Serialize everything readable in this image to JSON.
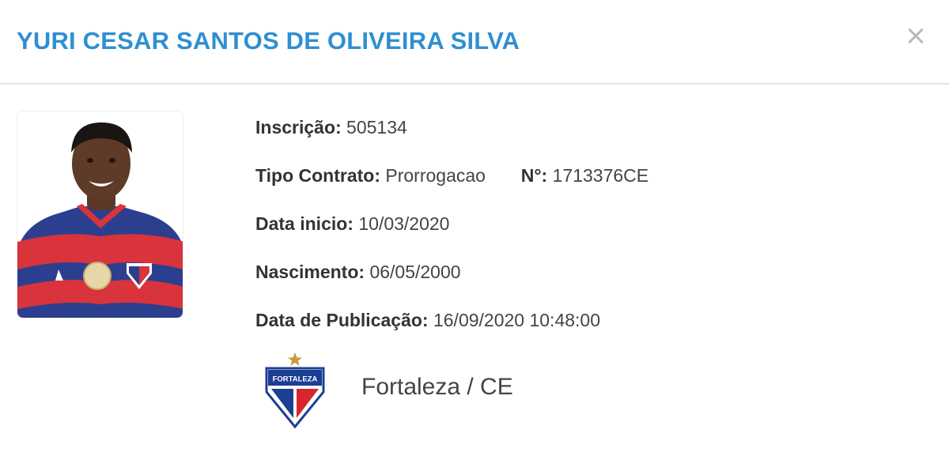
{
  "modal": {
    "title": "YURI CESAR SANTOS DE OLIVEIRA SILVA",
    "close_label": "×"
  },
  "player": {
    "inscricao_label": "Inscrição:",
    "inscricao_value": "505134",
    "tipo_contrato_label": "Tipo Contrato:",
    "tipo_contrato_value": "Prorrogacao",
    "numero_label": "N°:",
    "numero_value": "1713376CE",
    "data_inicio_label": "Data inicio:",
    "data_inicio_value": "10/03/2020",
    "nascimento_label": "Nascimento:",
    "nascimento_value": "06/05/2000",
    "publicacao_label": "Data de Publicação:",
    "publicacao_value": "16/09/2020 10:48:00"
  },
  "club": {
    "name": "Fortaleza / CE",
    "crest_text": "FORTALEZA",
    "colors": {
      "blue": "#1c3f94",
      "red": "#d7262e",
      "gold": "#c79a3b"
    }
  },
  "colors": {
    "title": "#2f8fd1",
    "divider": "#e3e3e3",
    "close": "#b5b5b5"
  }
}
